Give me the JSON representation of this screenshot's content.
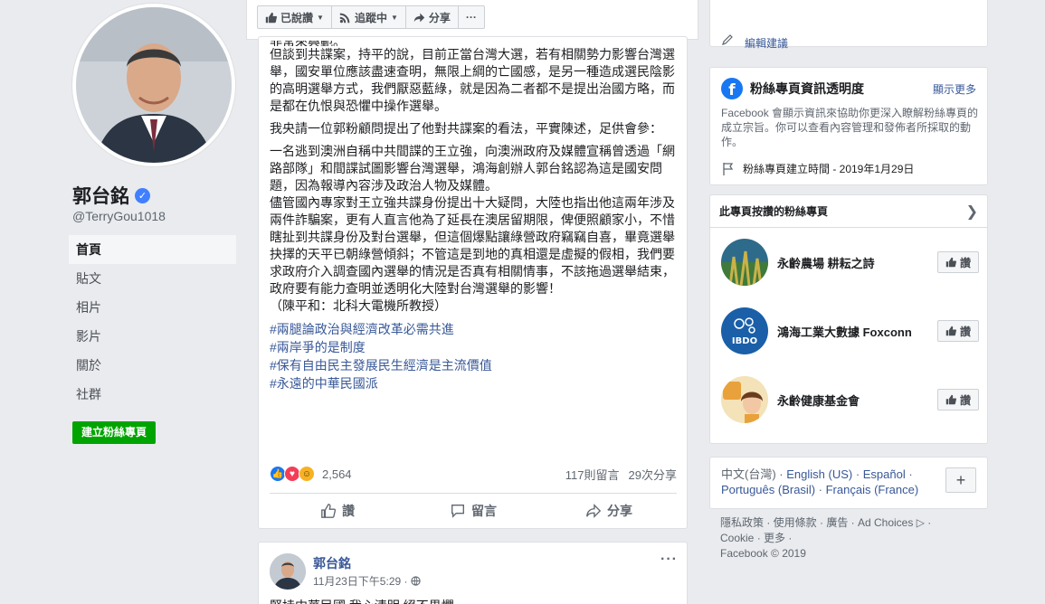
{
  "profile": {
    "name": "郭台銘",
    "handle": "@TerryGou1018",
    "verified_glyph": "✓",
    "nav": [
      "首頁",
      "貼文",
      "相片",
      "影片",
      "關於",
      "社群"
    ],
    "create_page_label": "建立粉絲專頁"
  },
  "topbar": {
    "liked_label": "已說讚",
    "following_label": "追蹤中",
    "share_label": "分享",
    "more_label": "···"
  },
  "post": {
    "cut_line": "非常來興範。",
    "paragraphs": [
      "但談到共諜案，持平的說，目前正當台灣大選，若有相關勢力影響台灣選舉，國安單位應該盡速查明，無限上綱的亡國感，是另一種造成選民陰影的高明選舉方式，我們厭惡藍綠，就是因為二者都不是提出治國方略，而是都在仇恨與恐懼中操作選舉。",
      "我央請一位郭粉顧問提出了他對共諜案的看法，平實陳述，足供會參：",
      "一名逃到澳洲自稱中共間諜的王立強，向澳洲政府及媒體宣稱曾透過「網路部隊」和間諜試圖影響台灣選舉，鴻海創辦人郭台銘認為這是國安問題，因為報導內容涉及政治人物及媒體。\n儘管國內專家對王立強共諜身份提出十大疑問，大陸也指出他這兩年涉及兩件詐騙案，更有人直言他為了延長在澳居留期限，俾便照顧家小，不惜瞎扯到共諜身份及對台選舉，但這個爆點讓綠營政府竊竊自喜，畢竟選舉抉擇的天平已朝綠營傾斜；不管這是到地的真相還是虛擬的假相，我們要求政府介入調查國內選舉的情況是否真有相關情事，不該拖過選舉結束，政府要有能力查明並透明化大陸對台灣選舉的影響！\n（陳平和：北科大電機所教授）"
    ],
    "hashtags": [
      "#兩腿論政治與經濟改革必需共進",
      "#兩岸爭的是制度",
      "#保有自由民主發展民生經濟是主流價值",
      "#永遠的中華民國派"
    ],
    "reaction_count": "2,564",
    "comments_count": "117則留言",
    "shares_count": "29次分享",
    "actions": [
      "讚",
      "留言",
      "分享"
    ]
  },
  "post2": {
    "author": "郭台銘",
    "time": "11月23日下午5:29 · ",
    "more": "···",
    "text_preview": "堅持中華民國 我心清明 絕不畏懼"
  },
  "sidebar": {
    "edit_link": "編輯建議",
    "transparency": {
      "title": "粉絲專頁資訊透明度",
      "see_more": "顯示更多",
      "body": "Facebook 會顯示資訊來協助你更深入瞭解粉絲專頁的成立宗旨。你可以查看內容管理和發佈者所採取的動作。",
      "created": "粉絲專頁建立時間 - 2019年1月29日"
    },
    "liked_pages": {
      "title": "此專頁按讚的粉絲專頁",
      "like_label": "讚",
      "items": [
        {
          "name": "永齡農場 耕耘之詩"
        },
        {
          "name": "鴻海工業大數據 Foxconn"
        },
        {
          "name": "永齡健康基金會"
        }
      ]
    },
    "languages": {
      "current": "中文(台灣)",
      "sep": " · ",
      "links": [
        "English (US)",
        "Español",
        "Português (Brasil)",
        "Français (France)"
      ],
      "plus": "+"
    },
    "footer": {
      "line1": "隱私政策 · 使用條款 · 廣告 · Ad Choices ▷ ·",
      "line2": "Cookie · 更多 ·",
      "line3": "Facebook © 2019"
    }
  },
  "colors": {
    "link": "#385898",
    "green_button": "#00a400",
    "facebook_blue": "#1877f2",
    "background": "#e9ebee"
  }
}
